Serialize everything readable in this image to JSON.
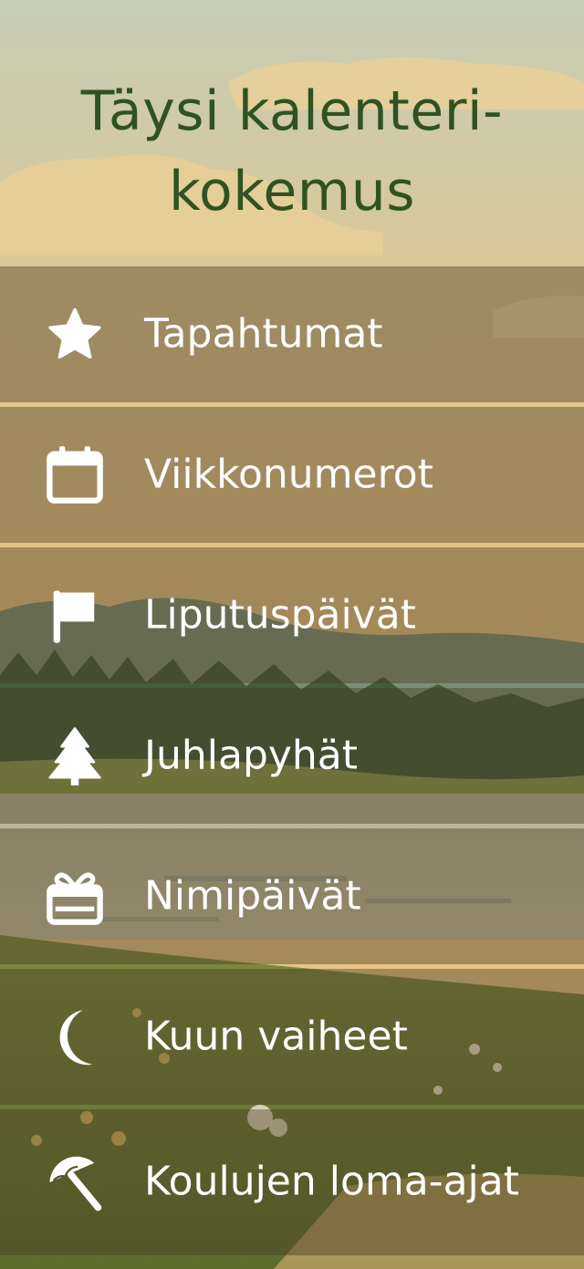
{
  "header": {
    "title_line1": "Täysi kalenteri-",
    "title_line2": "kokemus"
  },
  "menu": {
    "items": [
      {
        "label": "Tapahtumat",
        "icon": "star-icon"
      },
      {
        "label": "Viikkonumerot",
        "icon": "calendar-icon"
      },
      {
        "label": "Liputuspäivät",
        "icon": "flag-icon"
      },
      {
        "label": "Juhlapyhät",
        "icon": "tree-icon"
      },
      {
        "label": "Nimipäivät",
        "icon": "gift-icon"
      },
      {
        "label": "Kuun vaiheet",
        "icon": "moon-icon"
      },
      {
        "label": "Koulujen loma-ajat",
        "icon": "umbrella-icon"
      }
    ]
  },
  "colors": {
    "title": "#2f5320",
    "row_overlay": "rgba(72,58,34,0.42)",
    "label": "#ffffff"
  }
}
